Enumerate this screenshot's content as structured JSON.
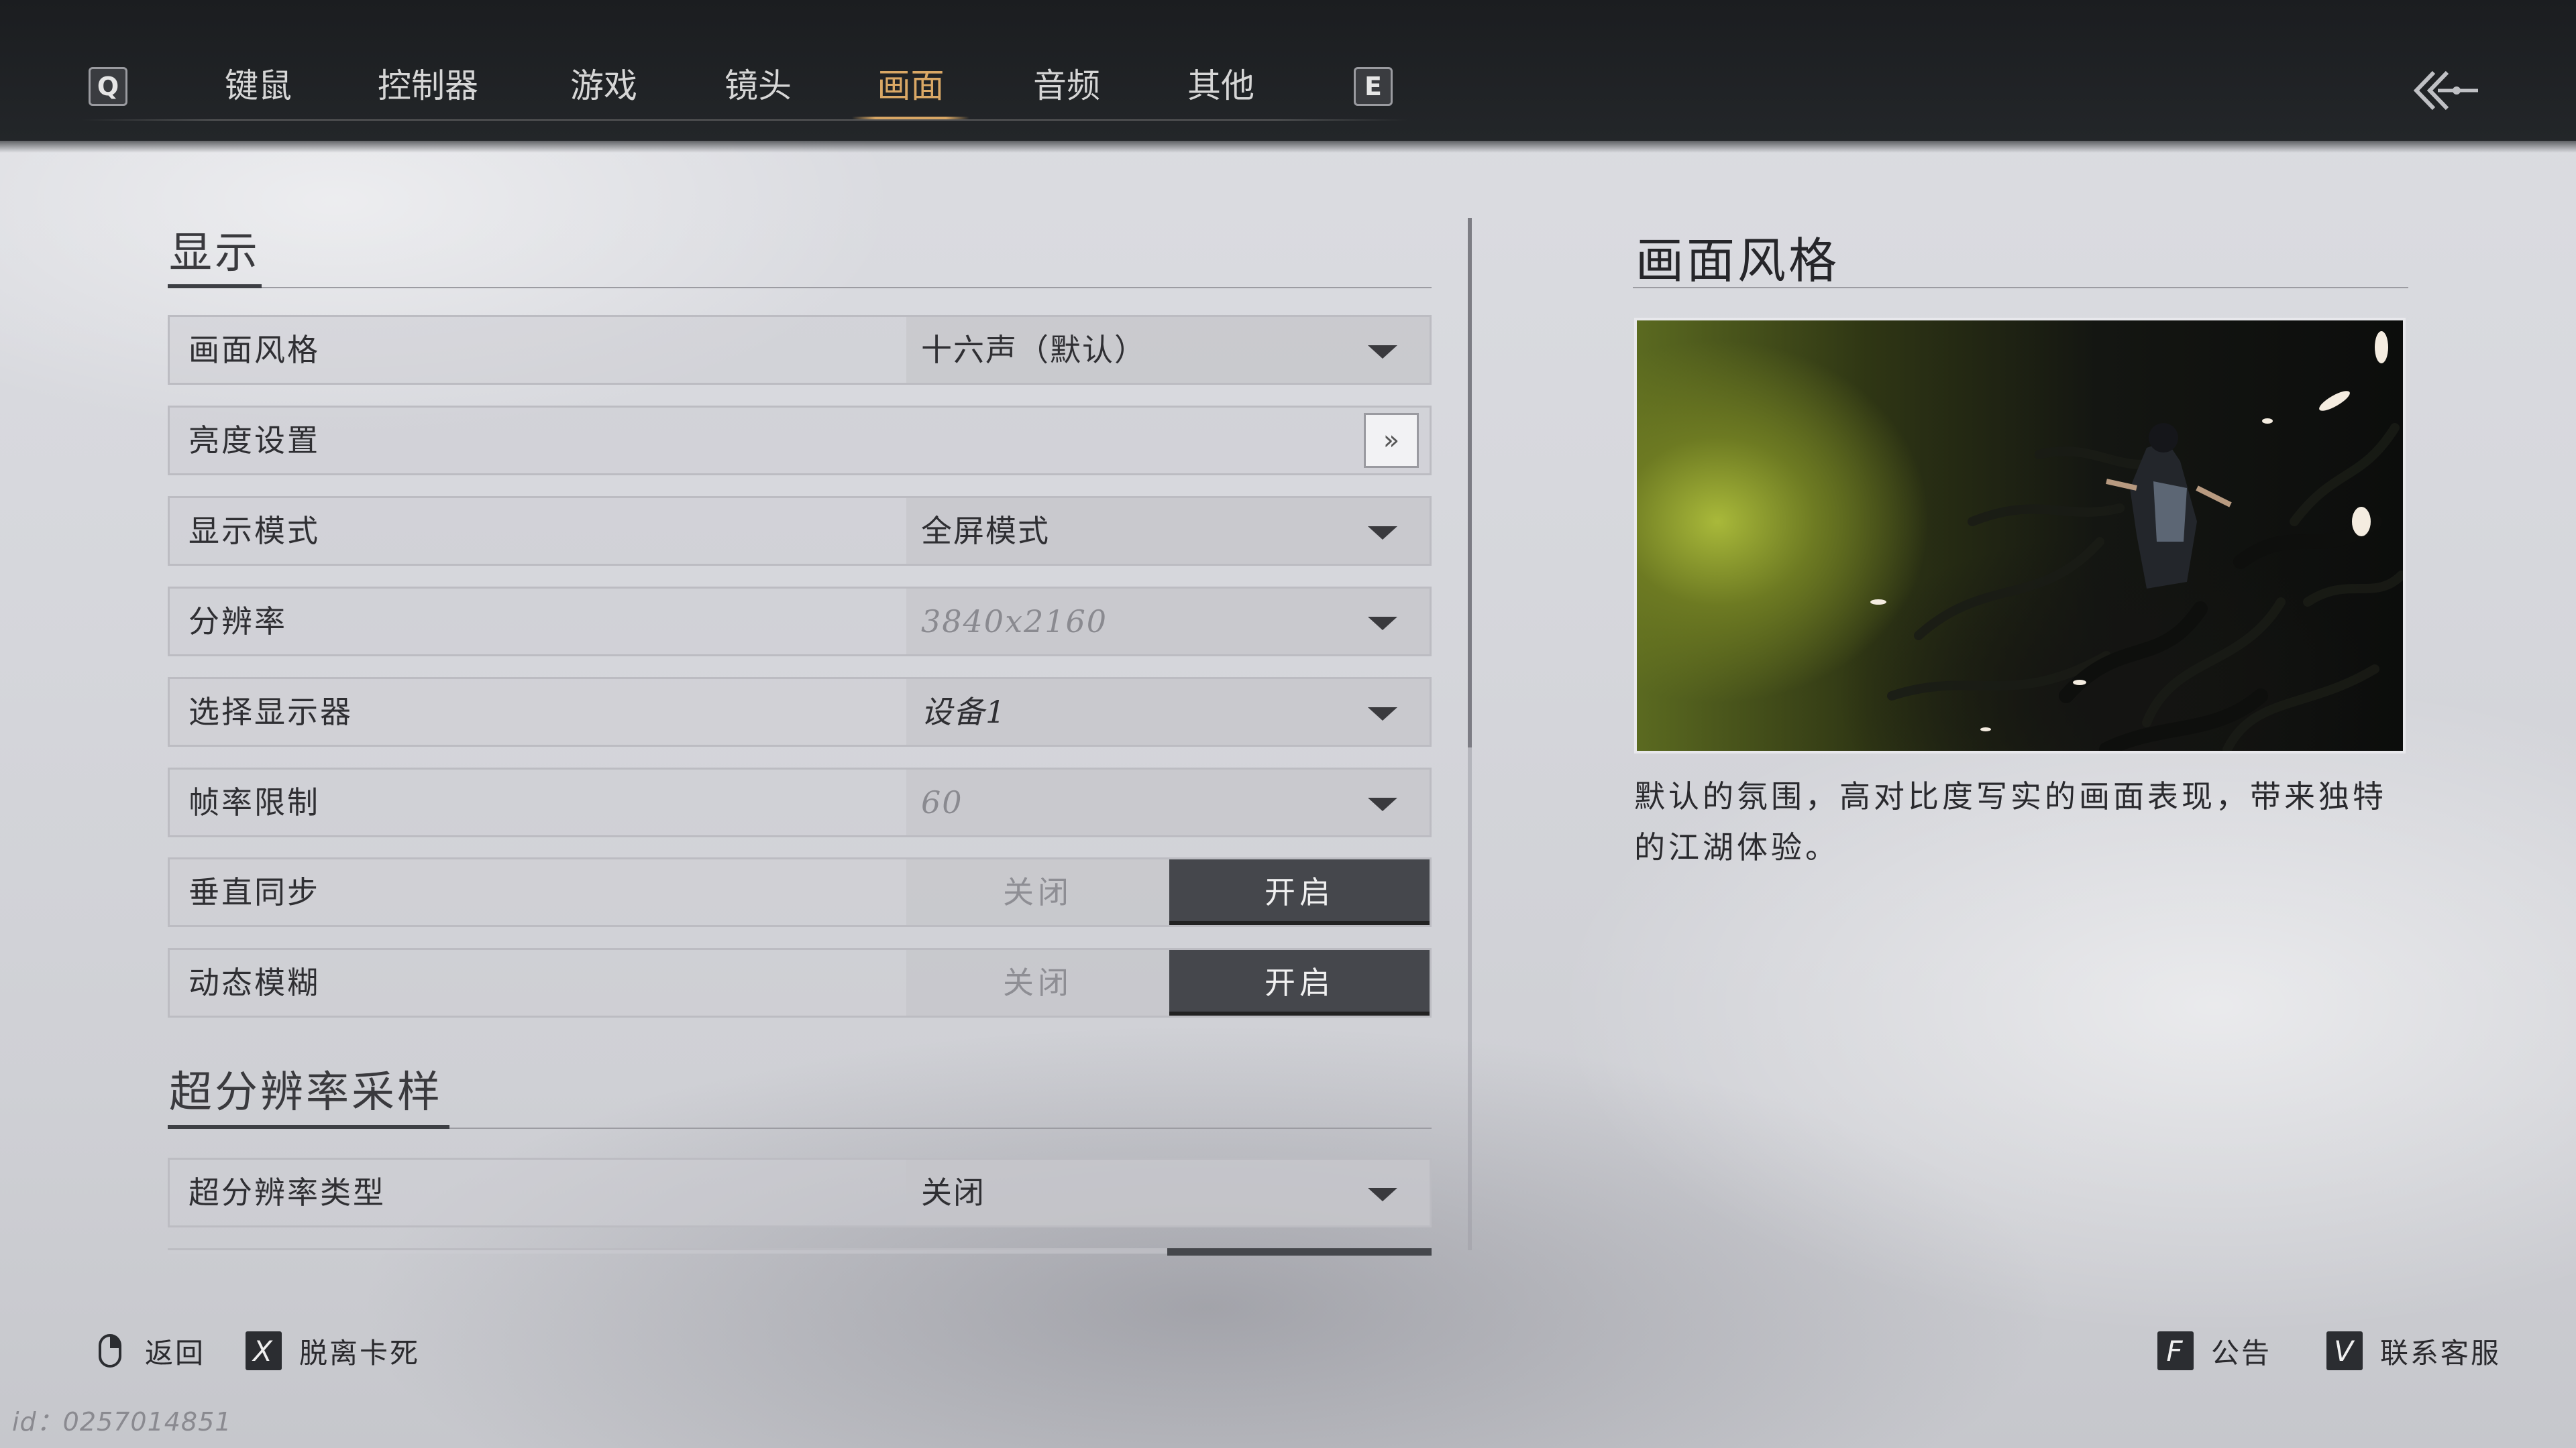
{
  "header": {
    "prev_key": "Q",
    "next_key": "E",
    "tabs": [
      {
        "label": "键鼠"
      },
      {
        "label": "控制器"
      },
      {
        "label": "游戏"
      },
      {
        "label": "镜头"
      },
      {
        "label": "画面"
      },
      {
        "label": "音频"
      },
      {
        "label": "其他"
      }
    ],
    "active_tab": "画面",
    "accent_color": "#d9a765"
  },
  "display": {
    "section_title": "显示",
    "rows": {
      "style": {
        "label": "画面风格",
        "value": "十六声（默认）"
      },
      "brightness": {
        "label": "亮度设置",
        "button": "»"
      },
      "display_mode": {
        "label": "显示模式",
        "value": "全屏模式"
      },
      "resolution": {
        "label": "分辨率",
        "value": "3840x2160"
      },
      "monitor": {
        "label": "选择显示器",
        "value": "设备1"
      },
      "fps_limit": {
        "label": "帧率限制",
        "value": "60"
      },
      "vsync": {
        "label": "垂直同步",
        "off": "关闭",
        "on": "开启",
        "selected": "开启"
      },
      "motion_blur": {
        "label": "动态模糊",
        "off": "关闭",
        "on": "开启",
        "selected": "开启"
      }
    }
  },
  "upscaling": {
    "section_title": "超分辨率采样",
    "rows": {
      "type": {
        "label": "超分辨率类型",
        "value": "关闭"
      }
    }
  },
  "detail": {
    "title": "画面风格",
    "description": "默认的氛围，高对比度写实的画面表现，带来独特的江湖体验。"
  },
  "footer": {
    "back": "返回",
    "unstuck_key": "X",
    "unstuck": "脱离卡死",
    "notice_key": "F",
    "notice": "公告",
    "support_key": "V",
    "support": "联系客服",
    "uid": "id：0257014851"
  }
}
